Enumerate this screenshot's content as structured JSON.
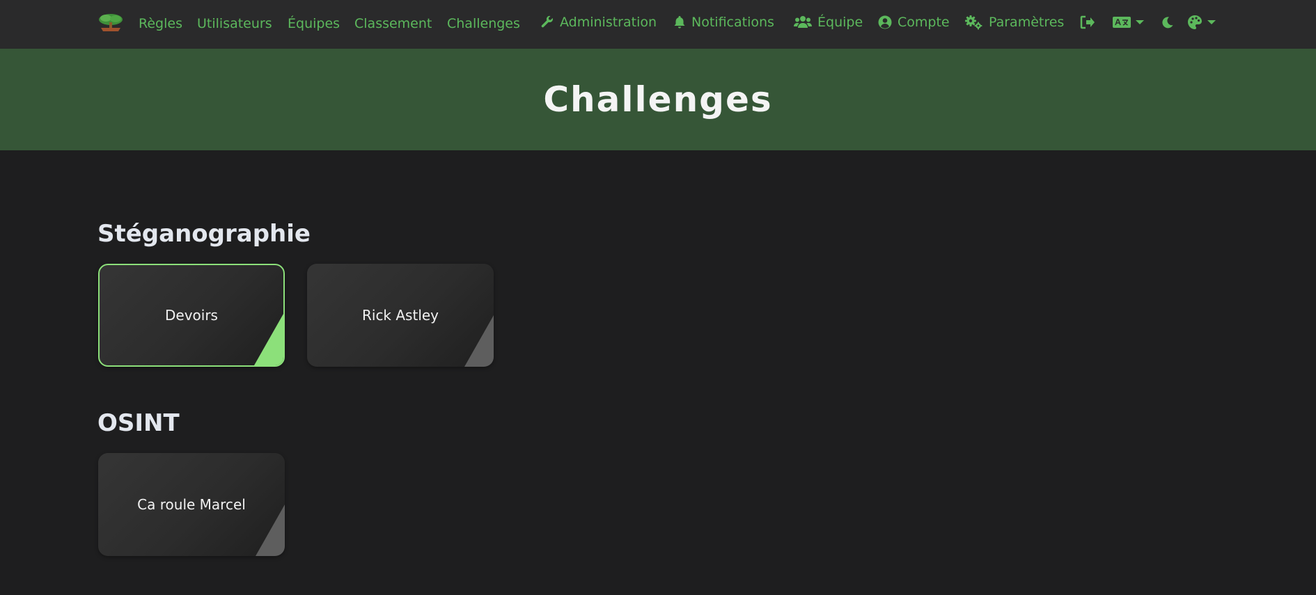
{
  "nav": {
    "left": [
      {
        "label": "Règles"
      },
      {
        "label": "Utilisateurs"
      },
      {
        "label": "Équipes"
      },
      {
        "label": "Classement"
      },
      {
        "label": "Challenges"
      }
    ],
    "right": [
      {
        "label": "Administration",
        "icon": "wrench-icon"
      },
      {
        "label": "Notifications",
        "icon": "bell-icon"
      },
      {
        "label": "Équipe",
        "icon": "users-icon"
      },
      {
        "label": "Compte",
        "icon": "user-circle-icon"
      },
      {
        "label": "Paramètres",
        "icon": "gears-icon"
      }
    ]
  },
  "header": {
    "title": "Challenges"
  },
  "categories": [
    {
      "name": "Stéganographie",
      "challenges": [
        {
          "name": "Devoirs",
          "solved": true
        },
        {
          "name": "Rick Astley",
          "solved": false
        }
      ]
    },
    {
      "name": "OSINT",
      "challenges": [
        {
          "name": "Ca roule Marcel",
          "solved": false
        }
      ]
    }
  ],
  "colors": {
    "accent": "#5cb85c",
    "navbar_bg": "#2a2a2b",
    "header_bg": "#365637",
    "page_bg": "#1e1e1f",
    "solved": "#8ce07a",
    "unsolved_corner": "#5e5e5e"
  }
}
